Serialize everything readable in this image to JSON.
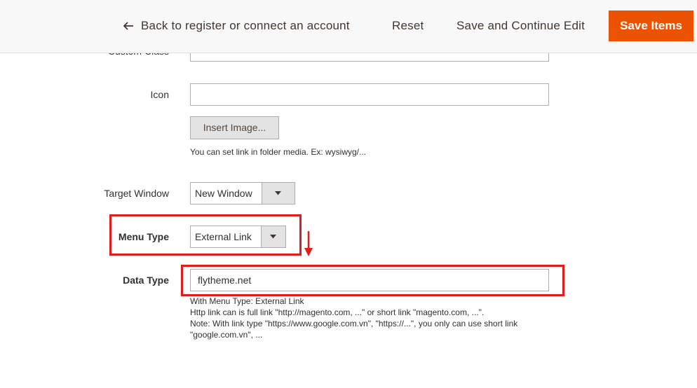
{
  "header": {
    "back_label": "Back to register or connect an account",
    "reset_label": "Reset",
    "save_continue_label": "Save and Continue Edit",
    "save_items_label": "Save Items"
  },
  "form": {
    "custom_class": {
      "label": "Custom Class",
      "value": ""
    },
    "icon": {
      "label": "Icon",
      "value": "",
      "insert_button": "Insert Image...",
      "note": "You can set link in folder media. Ex: wysiwyg/..."
    },
    "target_window": {
      "label": "Target Window",
      "selected": "New Window"
    },
    "menu_type": {
      "label": "Menu Type",
      "selected": "External Link"
    },
    "data_type": {
      "label": "Data Type",
      "value": "flytheme.net",
      "note_lines": [
        "With Menu Type: External Link",
        "Http link can is full link \"http://magento.com, ...\" or short link \"magento.com, ...\".",
        "Note: With link type \"https://www.google.com.vn\", \"https://...\", you only can use short link",
        "\"google.com.vn\", ..."
      ]
    }
  },
  "colors": {
    "accent": "#eb5202",
    "highlight": "#e11c1c",
    "header_bg": "#f8f8f8"
  }
}
